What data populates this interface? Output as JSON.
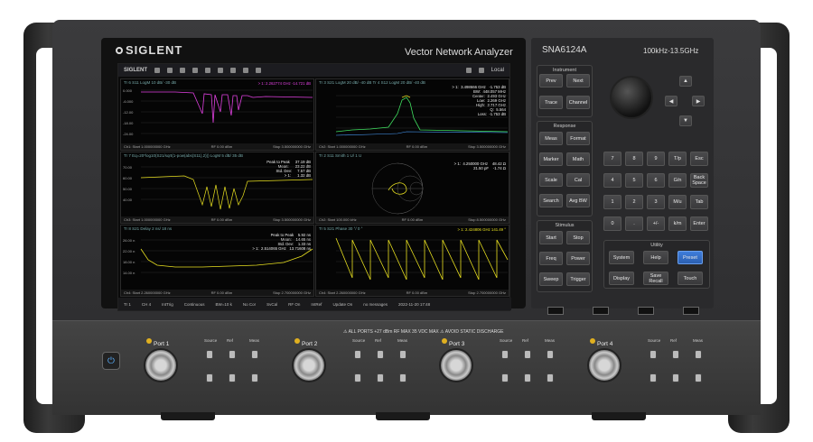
{
  "brand": "SIGLENT",
  "instrument_title": "Vector Network Analyzer",
  "model": "SNA6124A",
  "freq_range": "100kHz-13.5GHz",
  "toolbar": {
    "brand": "SIGLENT",
    "local": "Local"
  },
  "panes": [
    {
      "header": "Tr 6   S11 LogM 10 dB/ -30 dB",
      "marker": "> 1:  2.262774 GHz     -14.721 dB",
      "footer_l": "Ch1: Start 1.000000000 GHz",
      "footer_m": "RF 0.00 dBm",
      "footer_r": "Stop 3.500000000 GHz",
      "num": "1"
    },
    {
      "header": "Tr 3   S21 LogM 20 dB/ -40 dB    Tr 4   S12 LogM 20 dB/ -40 dB",
      "marker": "> 1:  3.498666 GHz   -1.753 dB\nBW:  448.057 MHz\nCenter:  2.493 GHz\nLow:  2.269 GHz\nHigh:  2.717 GHz\nQ:  5.564\nLoss:  -1.753 dB",
      "footer_l": "Ch2: Start 1.000000000 GHz",
      "footer_m": "RF 0.00 dBm",
      "footer_r": "Stop 3.500000000 GHz",
      "num": "2"
    },
    {
      "header": "Tr 7   Eq=20*log10(S21/sqrt(1-pow(abs(S11),2))) LogM 5 dB/ 35 dB",
      "marker": "Peak to Peak     37.19 dB\nMean:      23.22 dB\nStd. Dev:     7.57 dB\n> 1:      1.32 dB",
      "footer_l": "Ch3: Start 1.000000000 GHz",
      "footer_m": "RF 0.00 dBm",
      "footer_r": "Stop 3.500000000 GHz",
      "num": "4"
    },
    {
      "header": "Tr 2   S11 Smith 1 U/ 1 U",
      "marker": "> 1:  4.250000 GHz    48.42 Ω\n21.50 pF    -1.74 Ω",
      "footer_l": "Ch2: Start 100.000 kHz",
      "footer_m": "RF 0.00 dBm",
      "footer_r": "Stop 8.500000000 GHz",
      "num": "3"
    },
    {
      "header": "Tr 8   S21 Delay 2 ns/ 18 ns",
      "marker": "Peak to Peak    5.92 ns\nMean:    14.65 ns\nStd. Dev:    1.33 ns\n> 1:  2.514065 GHz   13.71608 ns",
      "footer_l": "Ch4: Start 2.260000000 GHz",
      "footer_m": "RF 0.00 dBm",
      "footer_r": "Stop 2.700000000 GHz",
      "num": "5"
    },
    {
      "header": "Tr 5   S21 Phase 30 °/ 0 °",
      "marker": "> 1:  2.424806 GHz    141.49 °",
      "footer_l": "Ch4: Start 2.260000000 GHz",
      "footer_m": "RF 0.00 dBm",
      "footer_r": "Stop 2.700000000 GHz",
      "num": "6"
    }
  ],
  "pane_axis": {
    "p0": [
      "0.000",
      "-6.000",
      "-12.00",
      "-18.00",
      "-24.00",
      "-30.00"
    ],
    "p2": [
      "70.00",
      "60.00",
      "50.00",
      "40.00",
      "30.00",
      "20.00"
    ],
    "p4": [
      "26.00 n",
      "22.00 n",
      "18.00 n",
      "14.00 n",
      "10.00 n"
    ]
  },
  "status_bar": [
    "Tr 1",
    "CH 4",
    "IntTrig",
    "Continuous",
    "BW=10 k",
    "No Cor",
    "SvCal",
    "RF On",
    "IntRef",
    "Update On",
    "no messages",
    "2022-11-20 17:48"
  ],
  "groups": {
    "instrument": "Instrument",
    "response": "Response",
    "stimulus": "Stimulus",
    "utility": "Utility"
  },
  "keys": {
    "instrument": [
      "Prev",
      "Next",
      "Trace",
      "Channel"
    ],
    "response": [
      "Meas",
      "Format",
      "Marker",
      "Math",
      "Scale",
      "Cal",
      "Search",
      "Avg BW"
    ],
    "stimulus": [
      "Start",
      "Stop",
      "Freq",
      "Power",
      "Sweep",
      "Trigger"
    ],
    "numpad": [
      "7",
      "8",
      "9",
      "T/p",
      "Esc",
      "4",
      "5",
      "6",
      "G/n",
      "Back Space",
      "1",
      "2",
      "3",
      "M/u",
      "Tab",
      "0",
      ".",
      "+/-",
      "k/m",
      "Enter"
    ],
    "utility": [
      "System",
      "Help",
      "Preset",
      "Display",
      "Save Recall",
      "Touch"
    ]
  },
  "arrows": [
    "▲",
    "◀",
    "▶",
    "▼"
  ],
  "warning": "⚠ ALL PORTS +27 dBm RF MAX 35 VDC MAX  ⚠ AVOID STATIC DISCHARGE",
  "ports": [
    "Port 1",
    "Port 2",
    "Port 3",
    "Port 4"
  ],
  "jack_labels": [
    "Source",
    "Ref",
    "Meas"
  ],
  "power_icon": "⏻",
  "colors": {
    "trace_magenta": "#e040e0",
    "trace_yellow": "#e8e020",
    "trace_green": "#40e060",
    "trace_blue": "#4aa0ff",
    "preset": "#2b6fd0"
  }
}
